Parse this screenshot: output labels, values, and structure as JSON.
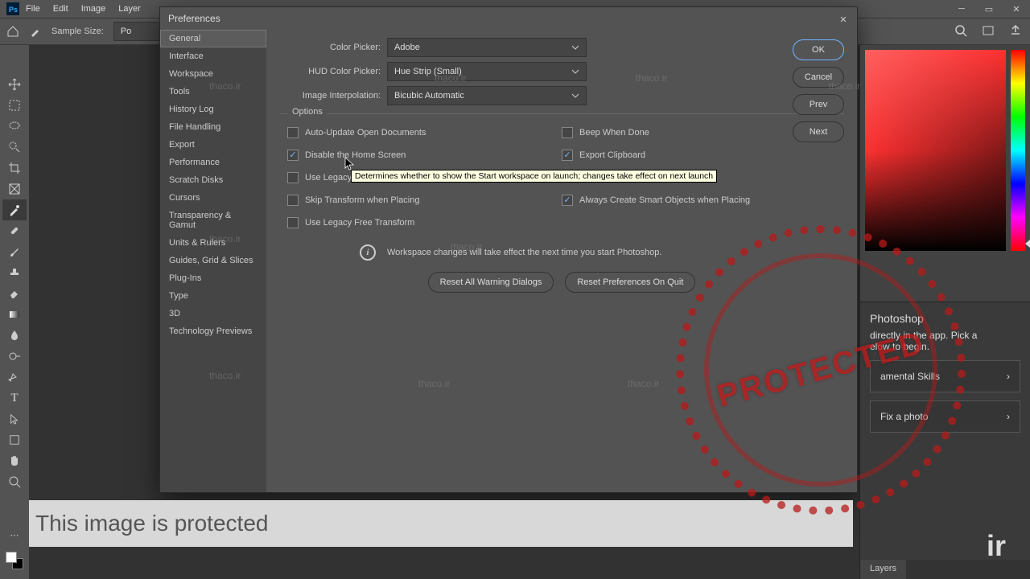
{
  "menubar": [
    "File",
    "Edit",
    "Image",
    "Layer"
  ],
  "toolbar": {
    "sample_label": "Sample Size:",
    "sample_value": "Po"
  },
  "dialog": {
    "title": "Preferences",
    "sidebar": [
      "General",
      "Interface",
      "Workspace",
      "Tools",
      "History Log",
      "File Handling",
      "Export",
      "Performance",
      "Scratch Disks",
      "Cursors",
      "Transparency & Gamut",
      "Units & Rulers",
      "Guides, Grid & Slices",
      "Plug-Ins",
      "Type",
      "3D",
      "Technology Previews"
    ],
    "sidebar_selected": 0,
    "rows": [
      {
        "label": "Color Picker:",
        "value": "Adobe"
      },
      {
        "label": "HUD Color Picker:",
        "value": "Hue Strip (Small)"
      },
      {
        "label": "Image Interpolation:",
        "value": "Bicubic Automatic"
      }
    ],
    "options_title": "Options",
    "options_left": [
      {
        "label": "Auto-Update Open Documents",
        "checked": false
      },
      {
        "label": "Disable the Home Screen",
        "checked": true
      },
      {
        "label": "Use Legacy",
        "checked": false
      },
      {
        "label": "Skip Transform when Placing",
        "checked": false
      },
      {
        "label": "Use Legacy Free Transform",
        "checked": false
      }
    ],
    "options_right": [
      {
        "label": "Beep When Done",
        "checked": false
      },
      {
        "label": "Export Clipboard",
        "checked": true
      },
      {
        "label": "",
        "checked": false,
        "hidden": true
      },
      {
        "label": "Always Create Smart Objects when Placing",
        "checked": true
      }
    ],
    "note": "Workspace changes will take effect the next time you start Photoshop.",
    "reset1": "Reset All Warning Dialogs",
    "reset2": "Reset Preferences On Quit",
    "buttons": {
      "ok": "OK",
      "cancel": "Cancel",
      "prev": "Prev",
      "next": "Next"
    }
  },
  "tooltip": "Determines whether to show the Start workspace on launch;  changes take effect on next launch",
  "learn": {
    "title": "Photoshop",
    "subtitle": "directly in the app. Pick a",
    "subtitle2": "elow to begin.",
    "card1": "amental Skills",
    "card2": "Fix a photo"
  },
  "tabs": [
    "Layers",
    "",
    "",
    ""
  ],
  "protected": "This image is protected",
  "watermark": "thaco.ir",
  "stamp": "PROTECTED",
  "corner": "ir"
}
